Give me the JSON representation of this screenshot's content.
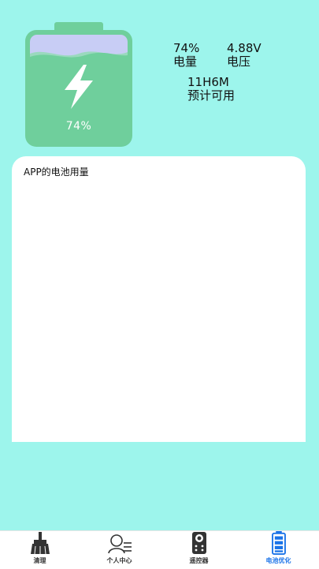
{
  "battery": {
    "level_percent": 74,
    "display_percent": "74%",
    "fill_color": "#6fcf9c",
    "empty_color": "#c8cdf5",
    "icon": "lightning-bolt-icon"
  },
  "stats": {
    "level": {
      "value": "74%",
      "label": "电量"
    },
    "voltage": {
      "value": "4.88V",
      "label": "电压"
    },
    "remaining": {
      "value": "11H6M",
      "label": "预计可用"
    }
  },
  "panel": {
    "title": "APP的电池用量"
  },
  "tabs": [
    {
      "label": "清理",
      "icon": "broom-icon",
      "active": false
    },
    {
      "label": "个人中心",
      "icon": "user-list-icon",
      "active": false
    },
    {
      "label": "遥控器",
      "icon": "remote-control-icon",
      "active": false
    },
    {
      "label": "电池优化",
      "icon": "battery-icon",
      "active": true
    }
  ],
  "colors": {
    "background": "#9df5ec",
    "accent": "#1a73e8",
    "panel": "#ffffff"
  }
}
